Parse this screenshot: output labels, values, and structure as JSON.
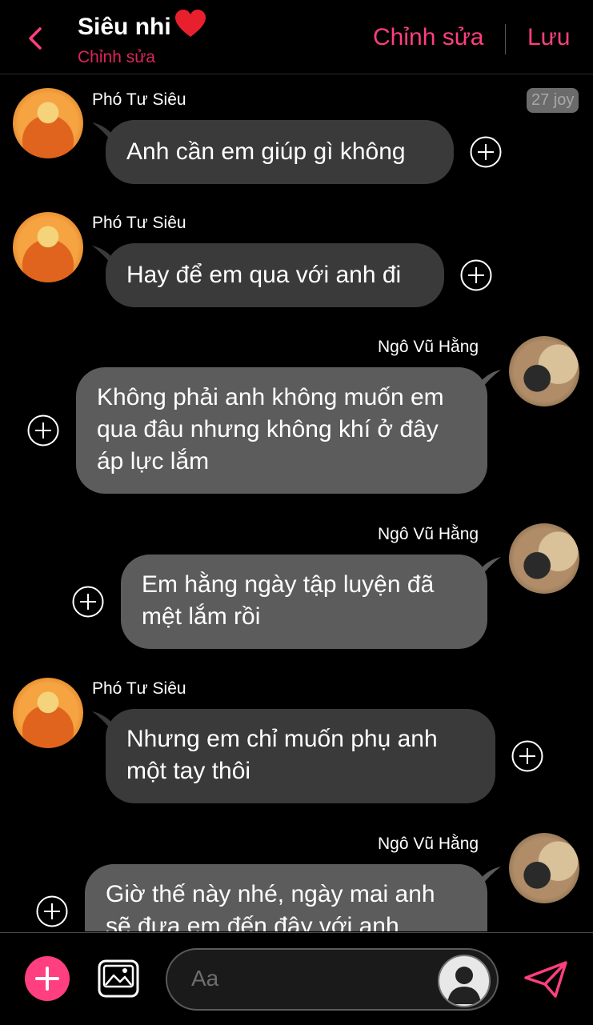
{
  "header": {
    "title": "Siêu nhi",
    "title_emoji": "❤️",
    "subtitle": "Chỉnh sửa",
    "edit_label": "Chỉnh sửa",
    "save_label": "Lưu"
  },
  "badge": "27 joy",
  "messages": [
    {
      "sender": "Phó Tư Siêu",
      "text": "Anh cần em giúp gì không",
      "side": "left"
    },
    {
      "sender": "Phó Tư Siêu",
      "text": "Hay để em qua với anh đi",
      "side": "left"
    },
    {
      "sender": "Ngô Vũ Hằng",
      "text": "Không phải anh không muốn em qua đâu nhưng không khí ở đây áp lực lắm",
      "side": "right"
    },
    {
      "sender": "Ngô Vũ Hằng",
      "text": "Em hằng ngày tập luyện đã mệt lắm rồi",
      "side": "right"
    },
    {
      "sender": "Phó Tư Siêu",
      "text": "Nhưng em chỉ muốn phụ anh một tay thôi",
      "side": "left"
    },
    {
      "sender": "Ngô Vũ Hằng",
      "text": "Giờ thế này nhé, ngày mai anh sẽ đưa em đến đây với anh",
      "side": "right"
    }
  ],
  "composer": {
    "placeholder": "Aa"
  },
  "colors": {
    "accent": "#ff3f7f",
    "subtitle": "#e0245e",
    "bubble_left": "#3a3a3a",
    "bubble_right": "#5c5c5c"
  },
  "icons": [
    "back-chevron-icon",
    "heart-icon",
    "add-reaction-icon",
    "add-icon",
    "image-icon",
    "avatar-icon",
    "send-icon"
  ]
}
